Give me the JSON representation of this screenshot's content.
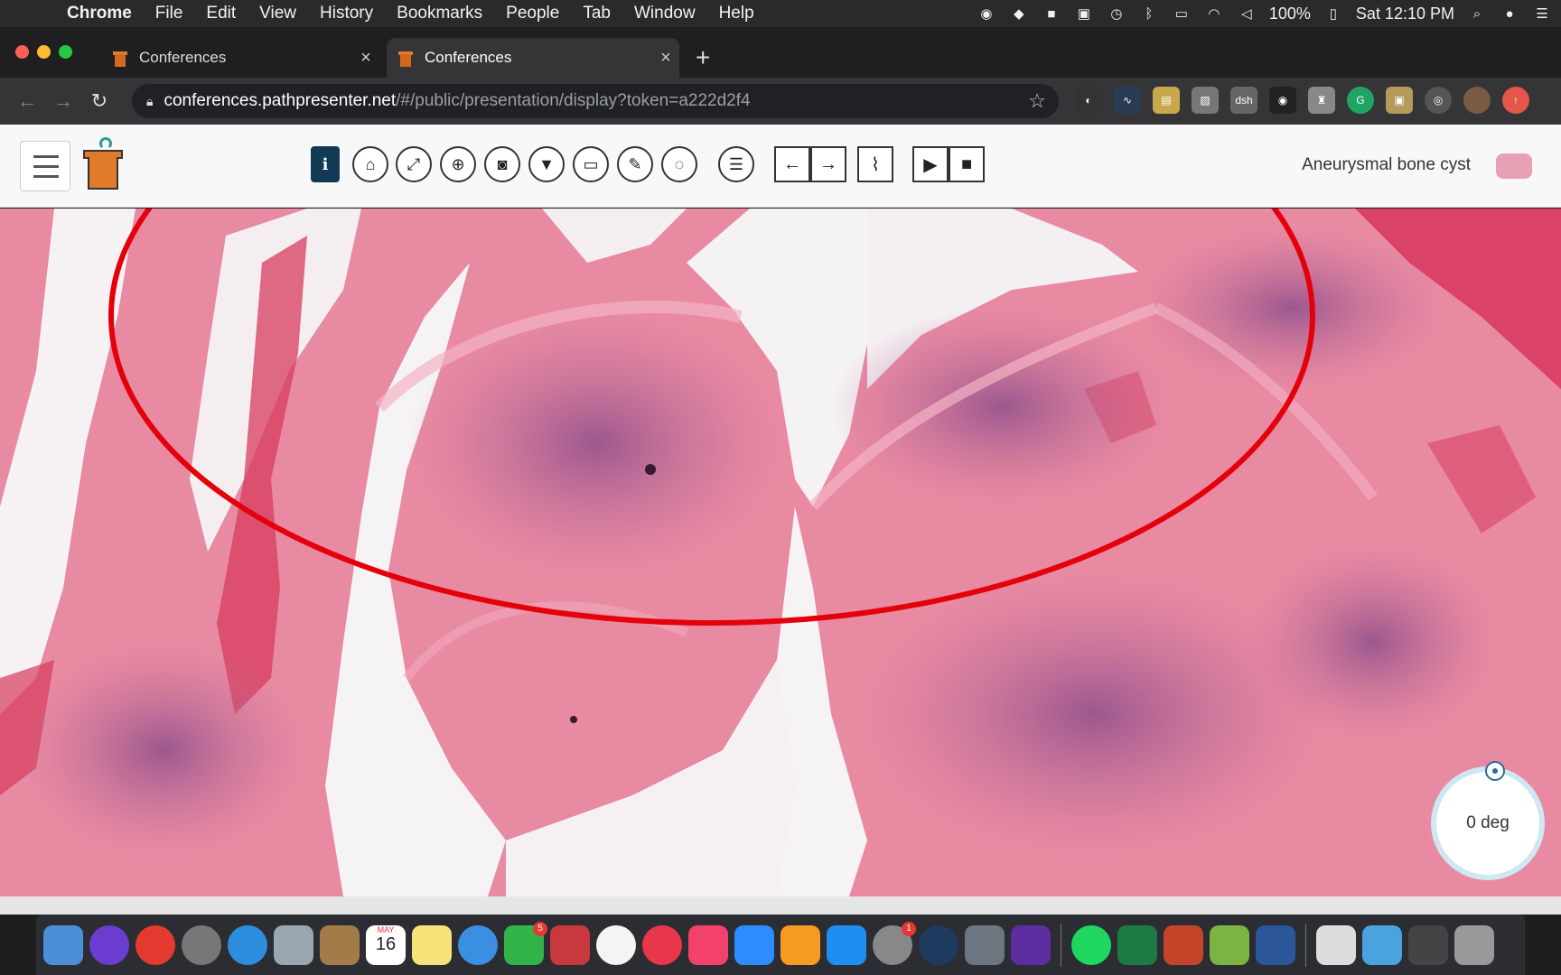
{
  "menubar": {
    "app": "Chrome",
    "items": [
      "File",
      "Edit",
      "View",
      "History",
      "Bookmarks",
      "People",
      "Tab",
      "Window",
      "Help"
    ],
    "battery": "100%",
    "clock": "Sat 12:10 PM"
  },
  "tabs": [
    {
      "title": "Conferences",
      "active": false
    },
    {
      "title": "Conferences",
      "active": true
    }
  ],
  "address_bar": {
    "host": "conferences.pathpresenter.net",
    "path": "/#/public/presentation/display?token=a222d2f4"
  },
  "extensions": [
    "dsh",
    "G"
  ],
  "viewer_header": {
    "slide_name": "Aneurysmal bone cyst",
    "tools": [
      "info-icon",
      "home-icon",
      "fullscreen-icon",
      "zoom-icon",
      "camera-icon",
      "filter-icon",
      "monitor-icon",
      "pencil-icon",
      "lasso-icon",
      "list-icon",
      "arrow-left-icon",
      "arrow-right-icon",
      "paperclip-icon",
      "video-camera-icon",
      "stop-icon"
    ]
  },
  "rotation": {
    "label": "0 deg"
  },
  "dock": {
    "calendar_month": "MAY",
    "calendar_day": "16",
    "badge_facetime": "5",
    "badge_settings": "1"
  },
  "colors": {
    "tissue_pink": "#e88aa2",
    "tissue_purple": "#9c5a8c",
    "annotation_red": "#e3000b",
    "info_button": "#123a56"
  }
}
